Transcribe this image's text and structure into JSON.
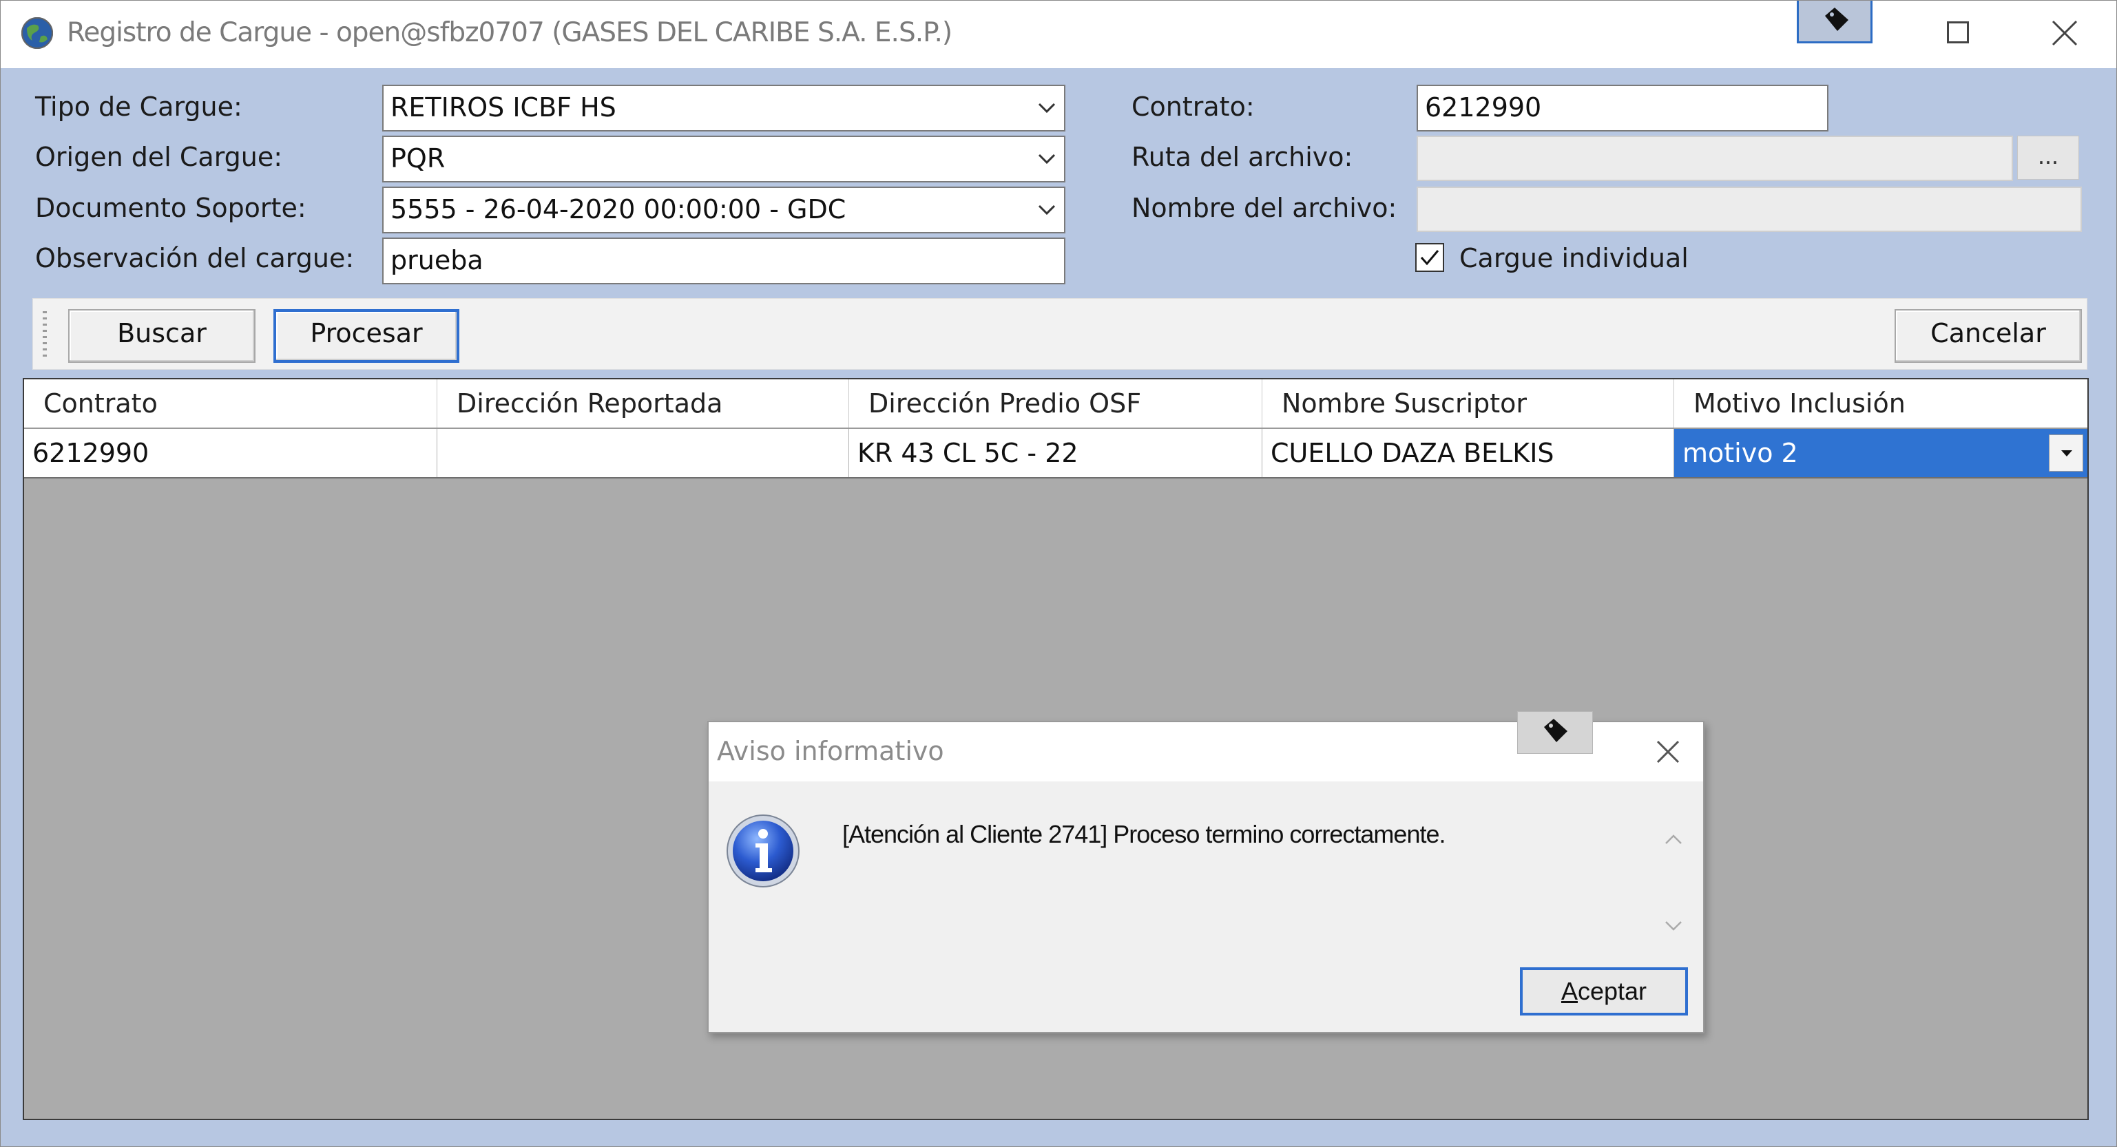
{
  "window": {
    "title": "Registro de Cargue - open@sfbz0707 (GASES DEL CARIBE S.A. E.S.P.)"
  },
  "form": {
    "tipo_label": "Tipo de Cargue:",
    "tipo_value": "RETIROS ICBF HS",
    "origen_label": "Origen del Cargue:",
    "origen_value": "PQR",
    "documento_label": "Documento Soporte:",
    "documento_value": "5555 - 26-04-2020 00:00:00 - GDC",
    "observacion_label": "Observación del cargue:",
    "observacion_value": "prueba",
    "contrato_label": "Contrato:",
    "contrato_value": "6212990",
    "ruta_label": "Ruta del  archivo:",
    "ruta_value": "",
    "browse_label": "...",
    "nombre_label": "Nombre del archivo:",
    "nombre_value": "",
    "cargue_individual_label": "Cargue individual",
    "cargue_individual_checked": true
  },
  "toolbar": {
    "buscar_label": "Buscar",
    "procesar_label": "Procesar",
    "cancelar_label": "Cancelar"
  },
  "grid": {
    "columns": [
      "Contrato",
      "Dirección Reportada",
      "Dirección Predio OSF",
      "Nombre Suscriptor",
      "Motivo Inclusión"
    ],
    "rows": [
      [
        "6212990",
        "",
        "KR 43 CL 5C - 22",
        "CUELLO DAZA BELKIS",
        "motivo 2"
      ]
    ]
  },
  "dialog": {
    "title": "Aviso informativo",
    "message": "[Atención al Cliente 2741] Proceso termino correctamente.",
    "ok_accel": "A",
    "ok_rest": "ceptar"
  },
  "colors": {
    "window_bg": "#b7c7e2",
    "focus_border": "#2f6fd0",
    "selected_cell": "#2f73d2",
    "grid_empty": "#ababab"
  },
  "icons": [
    "app-globe-icon",
    "tag-icon",
    "maximize-icon",
    "close-icon",
    "dropdown-arrow-icon",
    "checkmark-icon",
    "info-icon",
    "scroll-up-icon",
    "scroll-down-icon"
  ]
}
